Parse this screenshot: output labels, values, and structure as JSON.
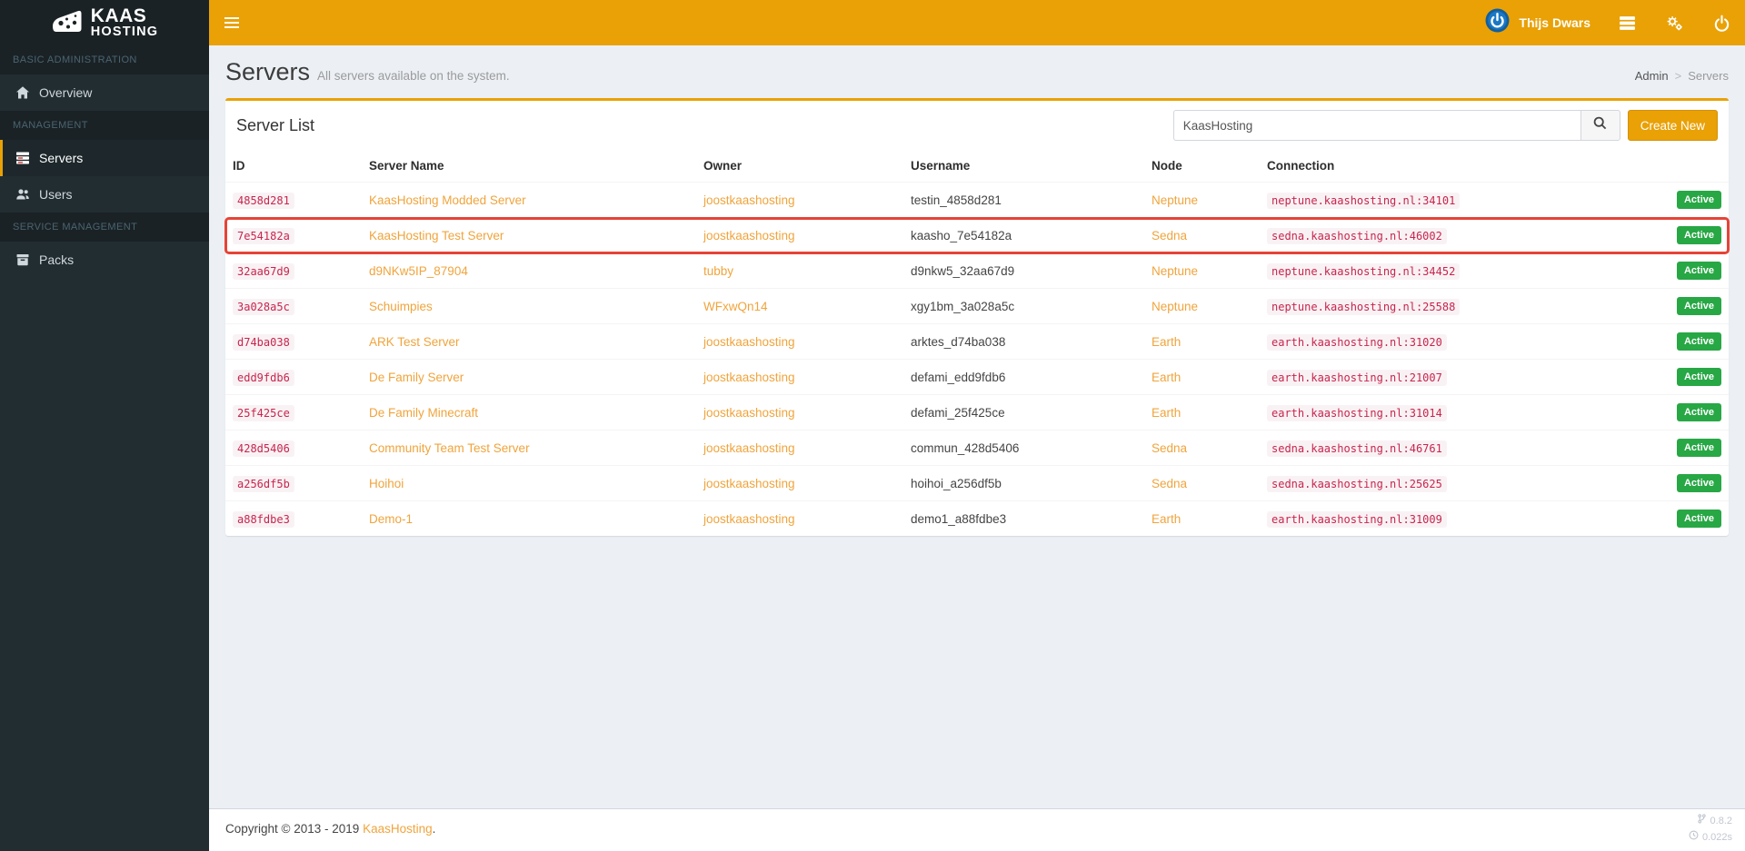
{
  "brand": {
    "line1": "KAAS",
    "line2": "HOSTING",
    "logo_icon": "cheese-icon"
  },
  "topbar": {
    "user_name": "Thijs Dwars",
    "icons": [
      "user-avatar-power-icon",
      "server-list-icon",
      "gears-icon",
      "power-icon"
    ]
  },
  "sidebar": {
    "sections": [
      {
        "header": "BASIC ADMINISTRATION",
        "items": [
          {
            "label": "Overview",
            "icon": "home-icon",
            "active": false
          }
        ]
      },
      {
        "header": "MANAGEMENT",
        "items": [
          {
            "label": "Servers",
            "icon": "servers-icon",
            "active": true
          },
          {
            "label": "Users",
            "icon": "users-icon",
            "active": false
          }
        ]
      },
      {
        "header": "SERVICE MANAGEMENT",
        "items": [
          {
            "label": "Packs",
            "icon": "box-icon",
            "active": false
          }
        ]
      }
    ]
  },
  "page": {
    "title": "Servers",
    "subtitle": "All servers available on the system.",
    "breadcrumb": {
      "items": [
        "Admin",
        "Servers"
      ],
      "separator": ">"
    }
  },
  "panel": {
    "title": "Server List",
    "search": {
      "value": "KaasHosting"
    },
    "search_icon": "search-icon",
    "create_button_label": "Create New",
    "table": {
      "columns": [
        "ID",
        "Server Name",
        "Owner",
        "Username",
        "Node",
        "Connection",
        ""
      ],
      "rows": [
        {
          "id": "4858d281",
          "name": "KaasHosting Modded Server",
          "owner": "joostkaashosting",
          "username": "testin_4858d281",
          "node": "Neptune",
          "connection": "neptune.kaashosting.nl:34101",
          "status": "Active",
          "highlighted": false
        },
        {
          "id": "7e54182a",
          "name": "KaasHosting Test Server",
          "owner": "joostkaashosting",
          "username": "kaasho_7e54182a",
          "node": "Sedna",
          "connection": "sedna.kaashosting.nl:46002",
          "status": "Active",
          "highlighted": true
        },
        {
          "id": "32aa67d9",
          "name": "d9NKw5IP_87904",
          "owner": "tubby",
          "username": "d9nkw5_32aa67d9",
          "node": "Neptune",
          "connection": "neptune.kaashosting.nl:34452",
          "status": "Active",
          "highlighted": false
        },
        {
          "id": "3a028a5c",
          "name": "Schuimpies",
          "owner": "WFxwQn14",
          "username": "xgy1bm_3a028a5c",
          "node": "Neptune",
          "connection": "neptune.kaashosting.nl:25588",
          "status": "Active",
          "highlighted": false
        },
        {
          "id": "d74ba038",
          "name": "ARK Test Server",
          "owner": "joostkaashosting",
          "username": "arktes_d74ba038",
          "node": "Earth",
          "connection": "earth.kaashosting.nl:31020",
          "status": "Active",
          "highlighted": false
        },
        {
          "id": "edd9fdb6",
          "name": "De Family Server",
          "owner": "joostkaashosting",
          "username": "defami_edd9fdb6",
          "node": "Earth",
          "connection": "earth.kaashosting.nl:21007",
          "status": "Active",
          "highlighted": false
        },
        {
          "id": "25f425ce",
          "name": "De Family Minecraft",
          "owner": "joostkaashosting",
          "username": "defami_25f425ce",
          "node": "Earth",
          "connection": "earth.kaashosting.nl:31014",
          "status": "Active",
          "highlighted": false
        },
        {
          "id": "428d5406",
          "name": "Community Team Test Server",
          "owner": "joostkaashosting",
          "username": "commun_428d5406",
          "node": "Sedna",
          "connection": "sedna.kaashosting.nl:46761",
          "status": "Active",
          "highlighted": false
        },
        {
          "id": "a256df5b",
          "name": "Hoihoi",
          "owner": "joostkaashosting",
          "username": "hoihoi_a256df5b",
          "node": "Sedna",
          "connection": "sedna.kaashosting.nl:25625",
          "status": "Active",
          "highlighted": false
        },
        {
          "id": "a88fdbe3",
          "name": "Demo-1",
          "owner": "joostkaashosting",
          "username": "demo1_a88fdbe3",
          "node": "Earth",
          "connection": "earth.kaashosting.nl:31009",
          "status": "Active",
          "highlighted": false
        }
      ]
    }
  },
  "footer": {
    "copyright": "Copyright © 2013 - 2019",
    "brand_link": "KaasHosting",
    "suffix": ".",
    "version": "0.8.2",
    "render_time": "0.022s",
    "version_icon": "git-branch-icon",
    "time_icon": "clock-icon"
  },
  "colors": {
    "accent_orange": "#e9a106",
    "link_orange": "#f0a43c",
    "sidebar_bg": "#222d32",
    "active_green": "#28a745",
    "highlight_red": "#e74336",
    "code_text": "#c7254e",
    "code_bg": "#f9f2f4"
  }
}
